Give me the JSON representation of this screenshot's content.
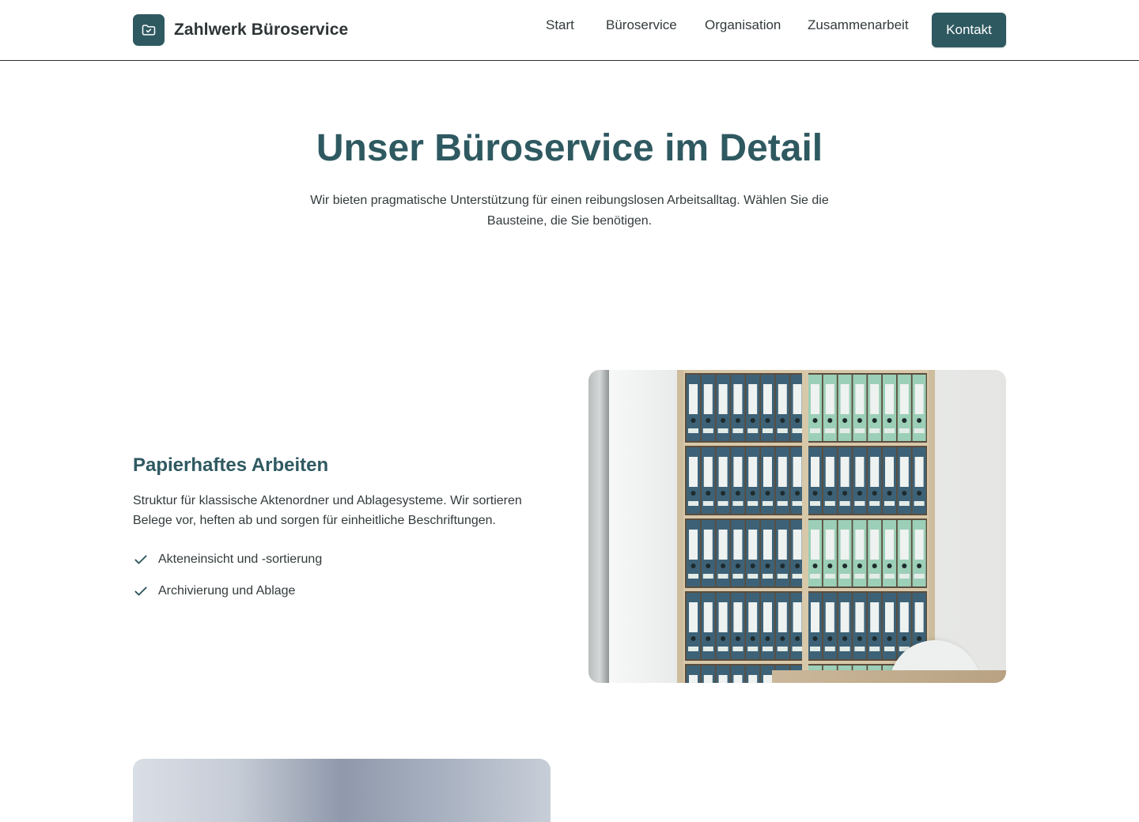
{
  "brand": {
    "name": "Zahlwerk Büroservice",
    "logo_icon": "folder-check-icon",
    "color": "#2f5961"
  },
  "nav": {
    "items": [
      "Start",
      "Büroservice",
      "Organisation",
      "Zusammenarbeit"
    ],
    "cta_label": "Kontakt"
  },
  "hero": {
    "title": "Unser Büroservice im Detail",
    "subtitle": "Wir bieten pragmatische Unterstützung für einen reibungslosen Arbeitsalltag. Wählen Sie die Bausteine, die Sie benötigen."
  },
  "section_paper": {
    "title": "Papierhaftes Arbeiten",
    "text": "Struktur für klassische Aktenordner und Ablagesysteme. Wir sortieren Belege vor, heften ab und sorgen für einheitliche Beschriftungen.",
    "features": [
      "Akteneinsicht und -sortierung",
      "Archivierung und Ablage"
    ],
    "feature_icon": "check-icon"
  },
  "colors": {
    "accent": "#2f5961",
    "binder_dark": "#3d6277",
    "binder_light": "#9ccfb7"
  }
}
